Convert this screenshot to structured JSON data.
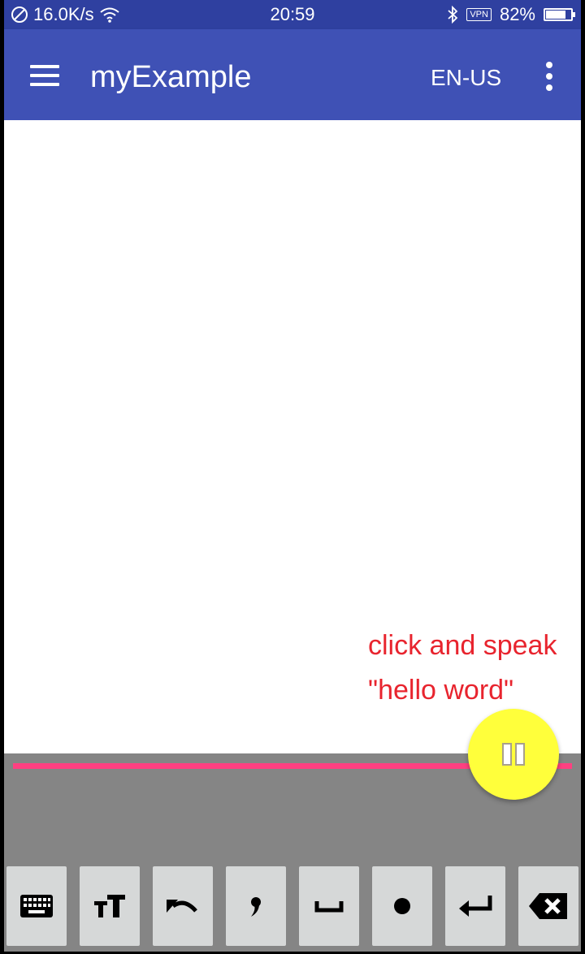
{
  "status_bar": {
    "net_speed": "16.0K/s",
    "time": "20:59",
    "vpn": "VPN",
    "battery": "82%",
    "battery_level": 0.82
  },
  "app_bar": {
    "title": "myExample",
    "locale": "EN-US"
  },
  "annotation": {
    "line1": "click and speak",
    "line2": "\"hello word\"",
    "color": "#e8242e"
  },
  "colors": {
    "primary": "#3f51b5",
    "status_bar": "#2f40a0",
    "accent_line": "#ff4081",
    "fab": "#ffff3b",
    "panel": "#858585",
    "key_bg": "#d6d8d8"
  },
  "fab": {
    "icon": "pause-icon"
  },
  "keys": [
    "keyboard-icon",
    "text-size-icon",
    "undo-icon",
    "comma-icon",
    "space-icon",
    "period-icon",
    "enter-icon",
    "backspace-icon"
  ]
}
